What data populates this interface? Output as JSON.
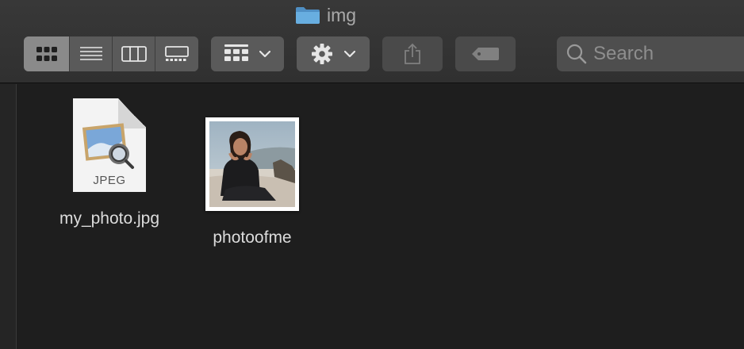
{
  "window": {
    "title": "img"
  },
  "toolbar": {
    "view_modes": [
      "icon-view",
      "list-view",
      "column-view",
      "gallery-view"
    ],
    "active_view": "icon-view",
    "group_button_icon": "grid-group-icon",
    "action_button_icon": "gear-icon",
    "share_button_icon": "share-icon",
    "tag_button_icon": "tag-icon"
  },
  "search": {
    "placeholder": "Search"
  },
  "files": [
    {
      "name": "my_photo.jpg",
      "type_label": "JPEG",
      "icon": "jpeg-document-icon"
    },
    {
      "name": "photoofme",
      "icon": "photo-thumbnail"
    }
  ],
  "colors": {
    "toolbar_bg": "#333333",
    "content_bg": "#1e1e1e",
    "folder_blue": "#5fa4d8",
    "label_text": "#dcdcdc"
  }
}
